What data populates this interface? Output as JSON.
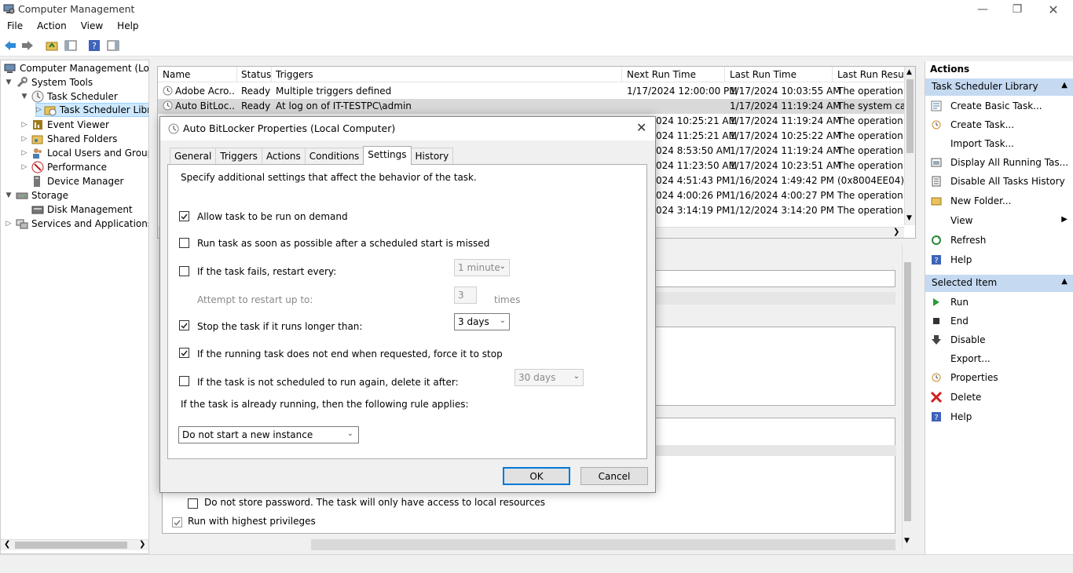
{
  "window": {
    "title": "Computer Management"
  },
  "menu": [
    "File",
    "Action",
    "View",
    "Help"
  ],
  "tree": {
    "items": [
      {
        "label": "Computer Management (Local",
        "level": 0
      },
      {
        "label": "System Tools",
        "level": 1
      },
      {
        "label": "Task Scheduler",
        "level": 2
      },
      {
        "label": "Task Scheduler Libra",
        "level": 3
      },
      {
        "label": "Event Viewer",
        "level": 2
      },
      {
        "label": "Shared Folders",
        "level": 2
      },
      {
        "label": "Local Users and Groups",
        "level": 2
      },
      {
        "label": "Performance",
        "level": 2
      },
      {
        "label": "Device Manager",
        "level": 2
      },
      {
        "label": "Storage",
        "level": 1
      },
      {
        "label": "Disk Management",
        "level": 2
      },
      {
        "label": "Services and Applications",
        "level": 1
      }
    ]
  },
  "grid": {
    "headers": [
      "Name",
      "Status",
      "Triggers",
      "Next Run Time",
      "Last Run Time",
      "Last Run Result"
    ],
    "rows": [
      [
        "Adobe Acro...",
        "Ready",
        "Multiple triggers defined",
        "1/17/2024 12:00:00 PM",
        "1/17/2024 10:03:55 AM",
        "The operation co"
      ],
      [
        "Auto BitLoc...",
        "Ready",
        "At log on of IT-TESTPC\\admin",
        "",
        "1/17/2024 11:19:24 AM",
        "The system cann"
      ],
      [
        "",
        "",
        "",
        "024 10:25:21 AM",
        "1/17/2024 11:19:24 AM",
        "The operation co"
      ],
      [
        "",
        "",
        "",
        "024 11:25:21 AM",
        "1/17/2024 10:25:22 AM",
        "The operation co"
      ],
      [
        "",
        "",
        "",
        "024 8:53:50 AM",
        "1/17/2024 11:19:24 AM",
        "The operation co"
      ],
      [
        "",
        "",
        "",
        "024 11:23:50 AM",
        "1/17/2024 10:23:51 AM",
        "The operation co"
      ],
      [
        "",
        "",
        "",
        "024 4:51:43 PM",
        "1/16/2024 1:49:42 PM",
        "(0x8004EE04)"
      ],
      [
        "",
        "",
        "",
        "024 4:00:26 PM",
        "1/16/2024 4:00:27 PM",
        "The operation co"
      ],
      [
        "",
        "",
        "",
        "024 3:14:19 PM",
        "1/12/2024 3:14:20 PM",
        "The operation co"
      ]
    ]
  },
  "lower_pane": {
    "do_not_store_password": "Do not store password.  The task will only have access to local resources",
    "run_highest": "Run with highest privileges"
  },
  "actions": {
    "header": "Actions",
    "section1": "Task Scheduler Library",
    "items1": [
      {
        "label": "Create Basic Task...",
        "icon": "create-basic-task-icon"
      },
      {
        "label": "Create Task...",
        "icon": "create-task-icon"
      },
      {
        "label": "Import Task...",
        "icon": ""
      },
      {
        "label": "Display All Running Tas...",
        "icon": "display-running-icon"
      },
      {
        "label": "Disable All Tasks History",
        "icon": "disable-history-icon"
      },
      {
        "label": "New Folder...",
        "icon": "folder-icon"
      },
      {
        "label": "View",
        "icon": ""
      },
      {
        "label": "Refresh",
        "icon": "refresh-icon"
      },
      {
        "label": "Help",
        "icon": "help-icon"
      }
    ],
    "section2": "Selected Item",
    "items2": [
      {
        "label": "Run",
        "icon": "run-icon"
      },
      {
        "label": "End",
        "icon": "end-icon"
      },
      {
        "label": "Disable",
        "icon": "disable-icon"
      },
      {
        "label": "Export...",
        "icon": ""
      },
      {
        "label": "Properties",
        "icon": "properties-icon"
      },
      {
        "label": "Delete",
        "icon": "delete-icon"
      },
      {
        "label": "Help",
        "icon": "help-icon"
      }
    ]
  },
  "dialog": {
    "title": "Auto BitLocker Properties (Local Computer)",
    "tabs": [
      "General",
      "Triggers",
      "Actions",
      "Conditions",
      "Settings",
      "History"
    ],
    "active_tab": "Settings",
    "intro": "Specify additional settings that affect the behavior of the task.",
    "opt_allow_demand": "Allow task to be run on demand",
    "opt_run_asap": "Run task as soon as possible after a scheduled start is missed",
    "opt_restart": "If the task fails, restart every:",
    "restart_interval": "1 minute",
    "attempt_label": "Attempt to restart up to:",
    "attempt_count": "3",
    "attempt_unit": "times",
    "opt_stop_long": "Stop the task if it runs longer than:",
    "stop_duration": "3 days",
    "opt_force_stop": "If the running task does not end when requested, force it to stop",
    "opt_delete": "If the task is not scheduled to run again, delete it after:",
    "delete_after": "30 days",
    "rule_label": "If the task is already running, then the following rule applies:",
    "rule_value": "Do not start a new instance",
    "ok": "OK",
    "cancel": "Cancel"
  }
}
